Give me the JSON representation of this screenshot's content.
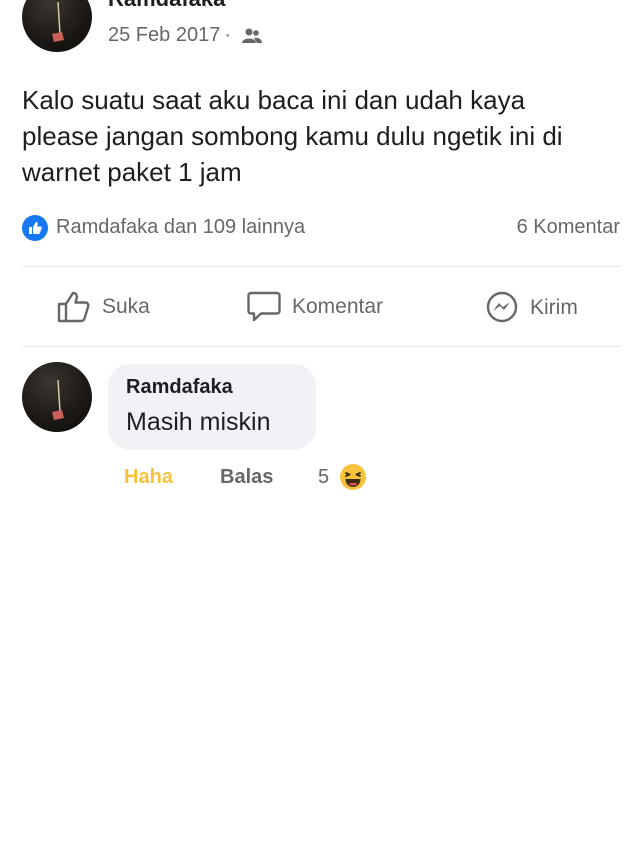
{
  "post": {
    "author": "Ramdafaka",
    "date": "25 Feb 2017",
    "separator": "·",
    "audience_icon": "friends-icon",
    "text_lines": [
      "Kalo suatu saat aku baca ini dan udah kaya",
      "please jangan sombong kamu dulu ngetik ini di",
      "warnet paket 1 jam"
    ]
  },
  "reactions": {
    "icon": "like-reaction-icon",
    "summary": "Ramdafaka dan 109 lainnya",
    "comments": "6 Komentar"
  },
  "actions": {
    "like_label": "Suka",
    "comment_label": "Komentar",
    "send_label": "Kirim"
  },
  "comment": {
    "author": "Ramdafaka",
    "text": "Masih miskin",
    "reaction_label": "Haha",
    "reply_label": "Balas",
    "reaction_count": "5",
    "reaction_icon": "haha-emoji-icon"
  },
  "colors": {
    "like_blue": "#1877f2",
    "haha_yellow": "#f7c33b",
    "muted_text": "#65676b",
    "bubble_bg": "#f0f2f5"
  }
}
